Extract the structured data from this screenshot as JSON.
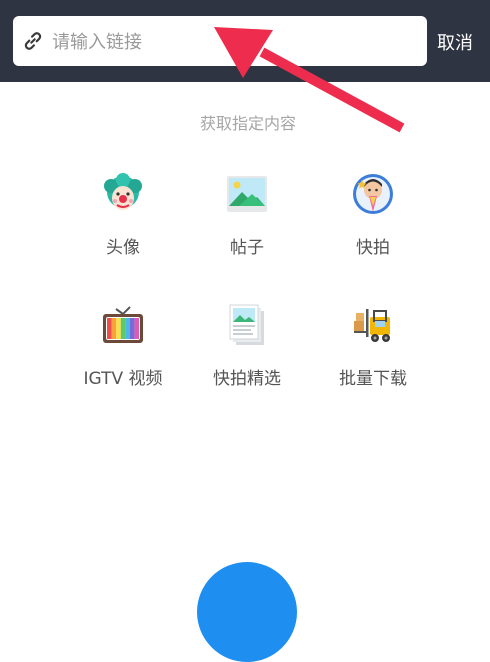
{
  "search": {
    "placeholder": "请输入链接"
  },
  "header": {
    "cancel_label": "取消"
  },
  "section": {
    "title": "获取指定内容"
  },
  "features": [
    {
      "label": "头像",
      "icon": "clown-avatar-icon"
    },
    {
      "label": "帖子",
      "icon": "picture-post-icon"
    },
    {
      "label": "快拍",
      "icon": "story-character-icon"
    },
    {
      "label": "IGTV 视频",
      "icon": "retro-tv-icon"
    },
    {
      "label": "快拍精选",
      "icon": "photo-stack-icon"
    },
    {
      "label": "批量下载",
      "icon": "forklift-icon"
    }
  ],
  "colors": {
    "header_bg": "#2f3443",
    "arrow": "#ee2d4e",
    "fab": "#1e8ff0"
  }
}
